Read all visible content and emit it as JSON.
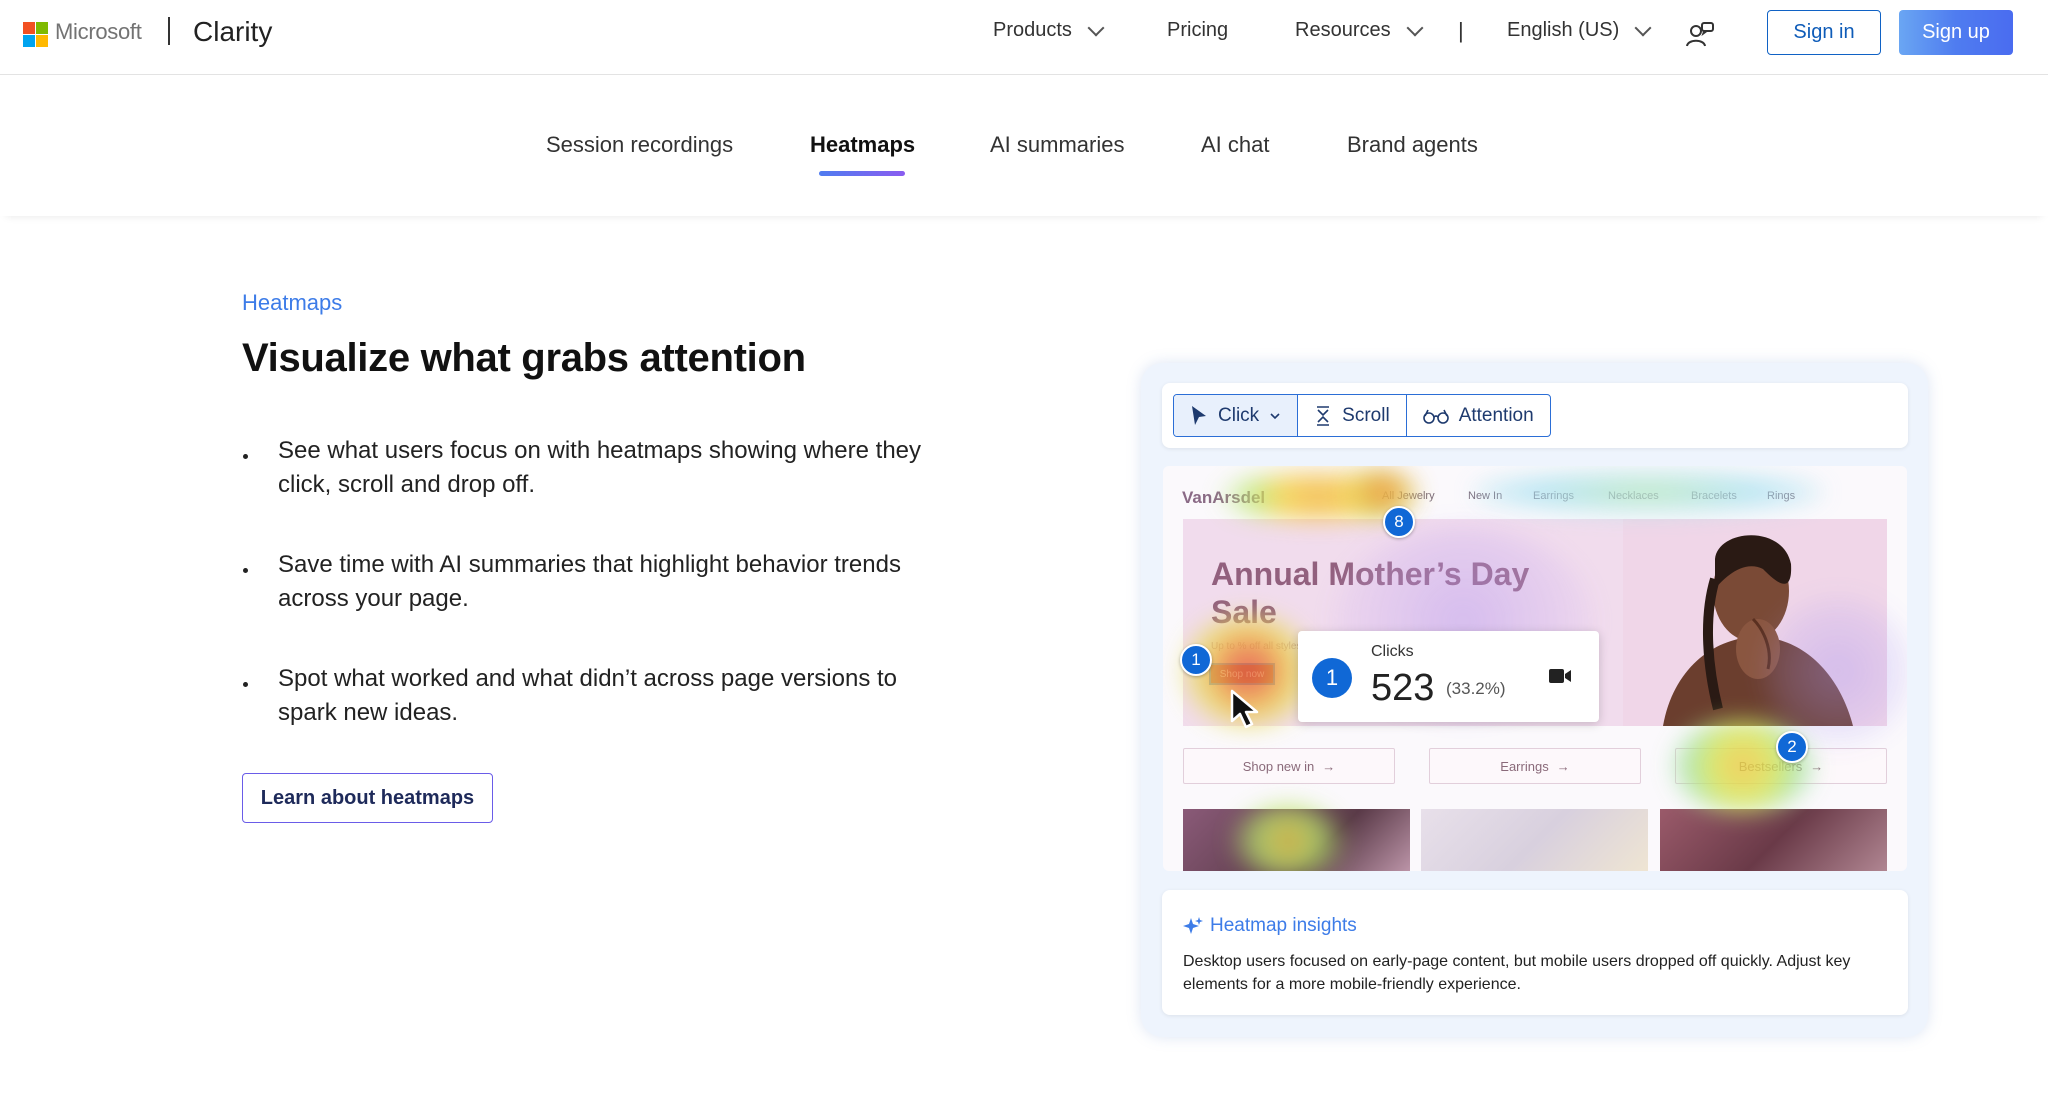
{
  "header": {
    "brand": "Microsoft",
    "app_name": "Clarity",
    "nav": {
      "products": "Products",
      "pricing": "Pricing",
      "resources": "Resources",
      "separator": "|",
      "language": "English (US)"
    },
    "sign_in": "Sign in",
    "sign_up": "Sign up",
    "logo_colors": [
      "#f25022",
      "#7fba00",
      "#00a4ef",
      "#ffb900"
    ]
  },
  "tabs": [
    {
      "label": "Session recordings",
      "active": false
    },
    {
      "label": "Heatmaps",
      "active": true
    },
    {
      "label": "AI summaries",
      "active": false
    },
    {
      "label": "AI chat",
      "active": false
    },
    {
      "label": "Brand agents",
      "active": false
    }
  ],
  "hero": {
    "eyebrow": "Heatmaps",
    "title": "Visualize what grabs attention",
    "bullets": [
      "See what users focus on with heatmaps showing where they click, scroll and drop off.",
      "Save time with AI summaries that highlight behavior trends across your page.",
      "Spot what worked and what didn’t across page versions to spark new ideas."
    ],
    "cta": "Learn about heatmaps"
  },
  "demo": {
    "toolbar": {
      "click": "Click",
      "scroll": "Scroll",
      "attention": "Attention"
    },
    "site": {
      "logo": "VanArsdel",
      "nav": [
        "All Jewelry",
        "New In",
        "Earrings",
        "Necklaces",
        "Bracelets",
        "Rings"
      ],
      "hero_title": "Annual Mother’s Day Sale",
      "hero_sub": "Up to % off all styles",
      "hero_button": "Shop now",
      "ctas": [
        "Shop new in",
        "Earrings",
        "Bestsellers"
      ]
    },
    "pins": [
      "1",
      "8",
      "2"
    ],
    "clicks": {
      "pin": "1",
      "label": "Clicks",
      "value": "523",
      "percent": "(33.2%)"
    },
    "insight": {
      "title": "Heatmap insights",
      "text": "Desktop users focused on early-page content, but mobile users dropped off quickly. Adjust key elements for a more mobile-friendly experience."
    },
    "accent_color": "#1068d6"
  }
}
